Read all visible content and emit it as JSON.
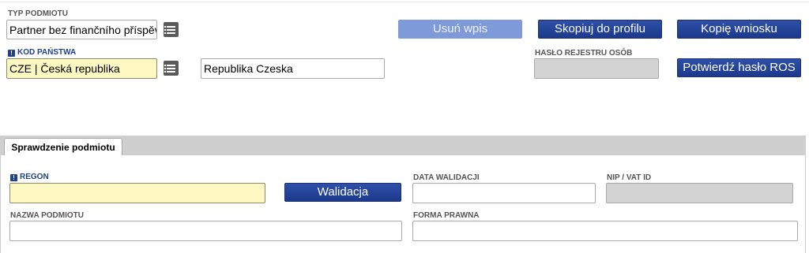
{
  "top": {
    "typ_podmiotu": {
      "label": "TYP PODMIOTU",
      "value": "Partner bez finančního příspěvku"
    },
    "kod_panstwa": {
      "label": "KOD PAŃSTWA",
      "value": "CZE | Česká republika",
      "country_name": "Republika Czeska"
    },
    "haslo": {
      "label": "HASŁO REJESTRU OSÓB",
      "value": ""
    },
    "buttons": {
      "usun": "Usuń wpis",
      "skopiuj": "Skopiuj do profilu",
      "kopie": "Kopię wniosku",
      "potwierdz": "Potwierdź hasło ROS"
    }
  },
  "tabs": [
    {
      "label": "Sprawdzenie podmiotu",
      "active": true
    }
  ],
  "check": {
    "regon": {
      "label": "REGON",
      "value": ""
    },
    "walidacja_button": "Walidacja",
    "data_walidacji": {
      "label": "DATA WALIDACJI",
      "value": ""
    },
    "nip": {
      "label": "NIP / VAT ID",
      "value": ""
    },
    "nazwa": {
      "label": "NAZWA PODMIOTU",
      "value": ""
    },
    "forma": {
      "label": "FORMA PRAWNA",
      "value": ""
    }
  },
  "colors": {
    "button_primary": "#1f3f96",
    "button_disabled": "#7f9ad9",
    "required_field_bg": "#fdf7c2",
    "readonly_field_bg": "#d3d3d3",
    "required_label": "#1f3f8f"
  },
  "icons": {
    "required": "exclamation-icon",
    "list": "list-icon"
  }
}
